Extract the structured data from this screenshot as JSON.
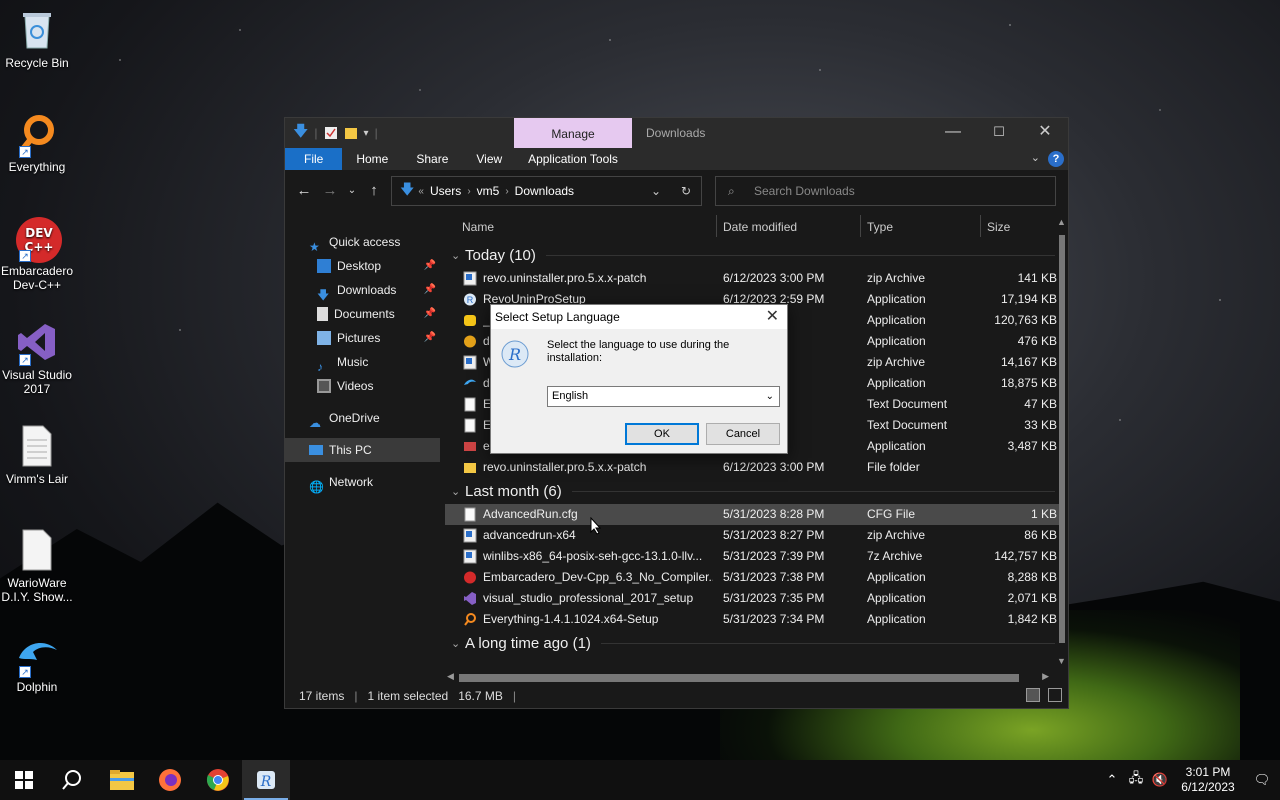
{
  "desktop": {
    "icons": [
      {
        "label": "Recycle Bin",
        "icon": "recycle-bin-icon"
      },
      {
        "label": "Everything",
        "icon": "everything-icon"
      },
      {
        "label": "Embarcadero Dev-C++",
        "icon": "devcpp-icon",
        "badge": "DEV C++"
      },
      {
        "label": "Visual Studio 2017",
        "icon": "visual-studio-icon"
      },
      {
        "label": "Vimm's Lair",
        "icon": "document-icon"
      },
      {
        "label": "WarioWare D.I.Y. Show...",
        "icon": "blank-file-icon"
      },
      {
        "label": "Dolphin",
        "icon": "dolphin-icon"
      }
    ]
  },
  "explorer": {
    "contextual_tab": "Manage",
    "title": "Downloads",
    "ribbon_tabs": [
      "File",
      "Home",
      "Share",
      "View"
    ],
    "app_tools": "Application Tools",
    "breadcrumbs": [
      "Users",
      "vm5",
      "Downloads"
    ],
    "search_placeholder": "Search Downloads",
    "nav": [
      {
        "label": "Quick access",
        "icon": "star-icon",
        "pinned": false
      },
      {
        "label": "Desktop",
        "icon": "desktop-folder-icon",
        "pinned": true
      },
      {
        "label": "Downloads",
        "icon": "download-arrow-icon",
        "pinned": true
      },
      {
        "label": "Documents",
        "icon": "documents-icon",
        "pinned": true
      },
      {
        "label": "Pictures",
        "icon": "pictures-icon",
        "pinned": true
      },
      {
        "label": "Music",
        "icon": "music-icon",
        "pinned": false
      },
      {
        "label": "Videos",
        "icon": "videos-icon",
        "pinned": false
      },
      {
        "label": "OneDrive",
        "icon": "cloud-icon",
        "pinned": false
      },
      {
        "label": "This PC",
        "icon": "computer-icon",
        "pinned": false
      },
      {
        "label": "Network",
        "icon": "network-icon",
        "pinned": false
      }
    ],
    "columns": [
      "Name",
      "Date modified",
      "Type",
      "Size"
    ],
    "groups": [
      {
        "label": "Today (10)",
        "rows": [
          {
            "name": "revo.uninstaller.pro.5.x.x-patch",
            "date": "6/12/2023 3:00 PM",
            "type": "zip Archive",
            "size": "141 KB",
            "icon": "zip-icon"
          },
          {
            "name": "RevoUninProSetup",
            "date": "6/12/2023 2:59 PM",
            "type": "Application",
            "size": "17,194 KB",
            "icon": "revo-icon"
          },
          {
            "name": "_",
            "date": "58 PM",
            "type": "Application",
            "size": "120,763 KB",
            "icon": "python-icon"
          },
          {
            "name": "d",
            "date": "51 PM",
            "type": "Application",
            "size": "476 KB",
            "icon": "setup-icon"
          },
          {
            "name": "W",
            "date": "20 PM",
            "type": "zip Archive",
            "size": "14,167 KB",
            "icon": "zip-icon"
          },
          {
            "name": "d",
            "date": "19 PM",
            "type": "Application",
            "size": "18,875 KB",
            "icon": "dolphin-small-icon"
          },
          {
            "name": "Em",
            "date": "07 PM",
            "type": "Text Document",
            "size": "47 KB",
            "icon": "text-file-icon"
          },
          {
            "name": "Em",
            "date": "02 PM",
            "type": "Text Document",
            "size": "33 KB",
            "icon": "text-file-icon"
          },
          {
            "name": "e",
            "date": "50 PM",
            "type": "Application",
            "size": "3,487 KB",
            "icon": "app-icon"
          },
          {
            "name": "revo.uninstaller.pro.5.x.x-patch",
            "date": "6/12/2023 3:00 PM",
            "type": "File folder",
            "size": "",
            "icon": "folder-icon"
          }
        ]
      },
      {
        "label": "Last month (6)",
        "rows": [
          {
            "name": "AdvancedRun.cfg",
            "date": "5/31/2023 8:28 PM",
            "type": "CFG File",
            "size": "1 KB",
            "icon": "cfg-file-icon",
            "selected": true
          },
          {
            "name": "advancedrun-x64",
            "date": "5/31/2023 8:27 PM",
            "type": "zip Archive",
            "size": "86 KB",
            "icon": "zip-icon"
          },
          {
            "name": "winlibs-x86_64-posix-seh-gcc-13.1.0-llv...",
            "date": "5/31/2023 7:39 PM",
            "type": "7z Archive",
            "size": "142,757 KB",
            "icon": "zip-icon"
          },
          {
            "name": "Embarcadero_Dev-Cpp_6.3_No_Compiler...",
            "date": "5/31/2023 7:38 PM",
            "type": "Application",
            "size": "8,288 KB",
            "icon": "devcpp-small-icon"
          },
          {
            "name": "visual_studio_professional_2017_setup",
            "date": "5/31/2023 7:35 PM",
            "type": "Application",
            "size": "2,071 KB",
            "icon": "vs-small-icon"
          },
          {
            "name": "Everything-1.4.1.1024.x64-Setup",
            "date": "5/31/2023 7:34 PM",
            "type": "Application",
            "size": "1,842 KB",
            "icon": "everything-small-icon"
          }
        ]
      },
      {
        "label": "A long time ago (1)",
        "rows": []
      }
    ],
    "status": {
      "items": "17 items",
      "selected": "1 item selected",
      "size": "16.7 MB"
    }
  },
  "dialog": {
    "title": "Select Setup Language",
    "message": "Select the language to use during the installation:",
    "language": "English",
    "ok": "OK",
    "cancel": "Cancel"
  },
  "taskbar": {
    "apps": [
      "start-icon",
      "search-icon",
      "file-explorer-icon",
      "firefox-icon",
      "chrome-icon",
      "revo-setup-icon"
    ],
    "time": "3:01 PM",
    "date": "6/12/2023"
  }
}
